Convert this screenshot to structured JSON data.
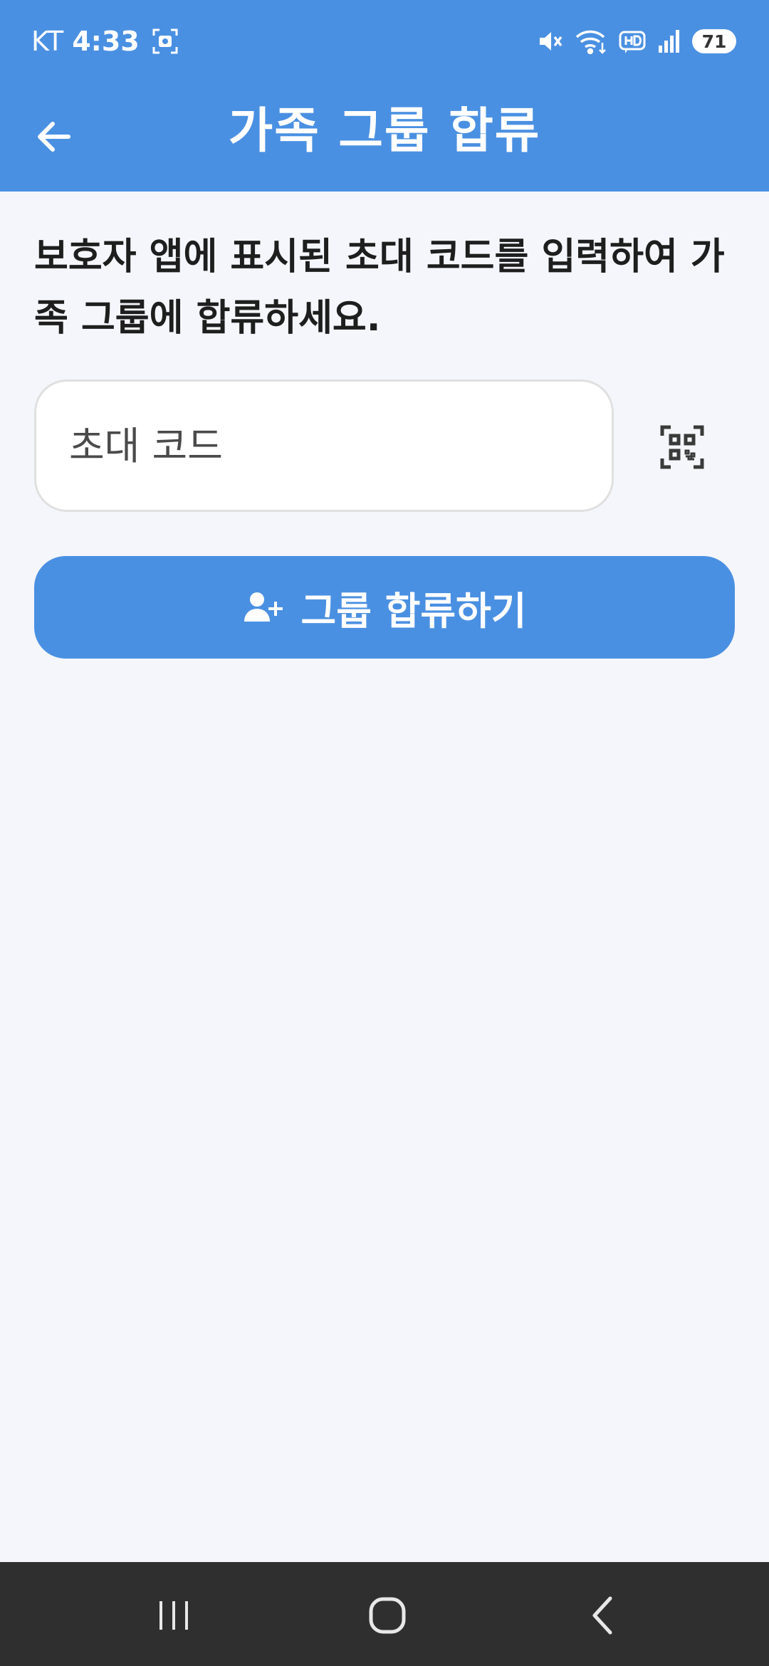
{
  "status_bar": {
    "carrier": "KT",
    "time": "4:33",
    "battery": "71",
    "icons": [
      "screenshot-icon",
      "mute-icon",
      "wifi-icon",
      "hd-icon",
      "signal-icon",
      "battery-icon"
    ]
  },
  "app_bar": {
    "title": "가족 그룹 합류",
    "back_icon": "arrow-left-icon",
    "color": "#4a90e2"
  },
  "content": {
    "description": "보호자 앱에 표시된 초대 코드를 입력하여 가족 그룹에 합류하세요.",
    "invite_code_placeholder": "초대 코드",
    "invite_code_value": "",
    "qr_icon": "qr-scan-icon",
    "join_button_label": "그룹 합류하기",
    "join_button_icon": "person-add-icon"
  },
  "nav_bar": {
    "items": [
      "recent-apps-icon",
      "home-icon",
      "back-icon"
    ]
  }
}
